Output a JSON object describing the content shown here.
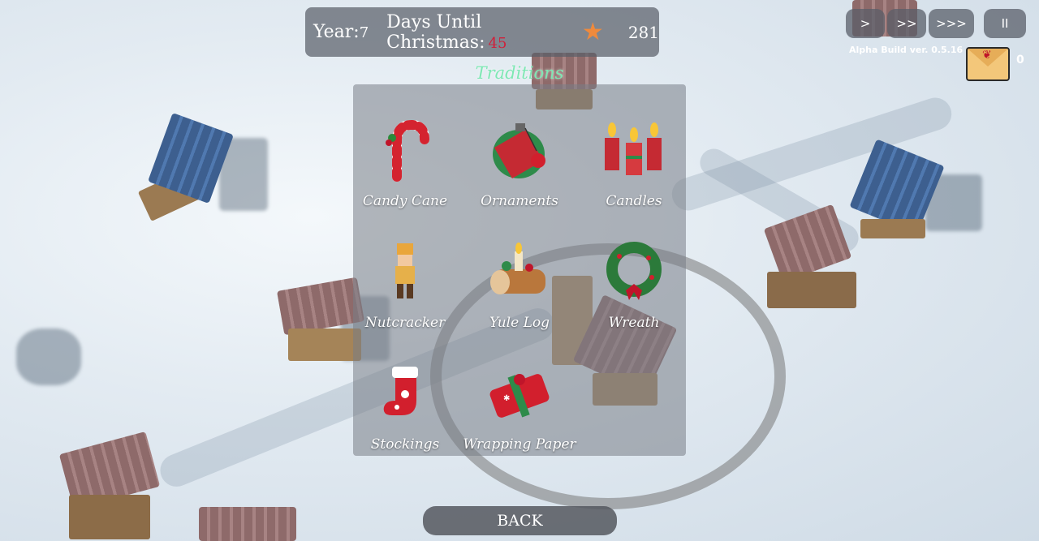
{
  "hud": {
    "year_label": "Year:",
    "year_value": "7",
    "days_label": "Days Until Christmas:",
    "days_value": "45",
    "star_icon": "star-icon",
    "score": "281"
  },
  "speed_controls": [
    {
      "label": ">"
    },
    {
      "label": ">>"
    },
    {
      "label": ">>>"
    },
    {
      "label": "II"
    }
  ],
  "build_version": "Alpha Build ver. 0.5.16",
  "mail": {
    "icon": "envelope-icon",
    "count": "0"
  },
  "traditions": {
    "title": "Traditions",
    "items": [
      {
        "label": "Candy Cane",
        "icon": "candy-cane-icon"
      },
      {
        "label": "Ornaments",
        "icon": "ornament-icon"
      },
      {
        "label": "Candles",
        "icon": "candles-icon"
      },
      {
        "label": "Nutcracker",
        "icon": "nutcracker-icon"
      },
      {
        "label": "Yule Log",
        "icon": "yule-log-icon"
      },
      {
        "label": "Wreath",
        "icon": "wreath-icon"
      },
      {
        "label": "Stockings",
        "icon": "stocking-icon"
      },
      {
        "label": "Wrapping Paper",
        "icon": "wrapping-paper-icon"
      }
    ]
  },
  "back_label": "BACK",
  "colors": {
    "days_value": "#d0203a",
    "title": "#7ee8b4",
    "accent_star": "#f08a3c"
  }
}
